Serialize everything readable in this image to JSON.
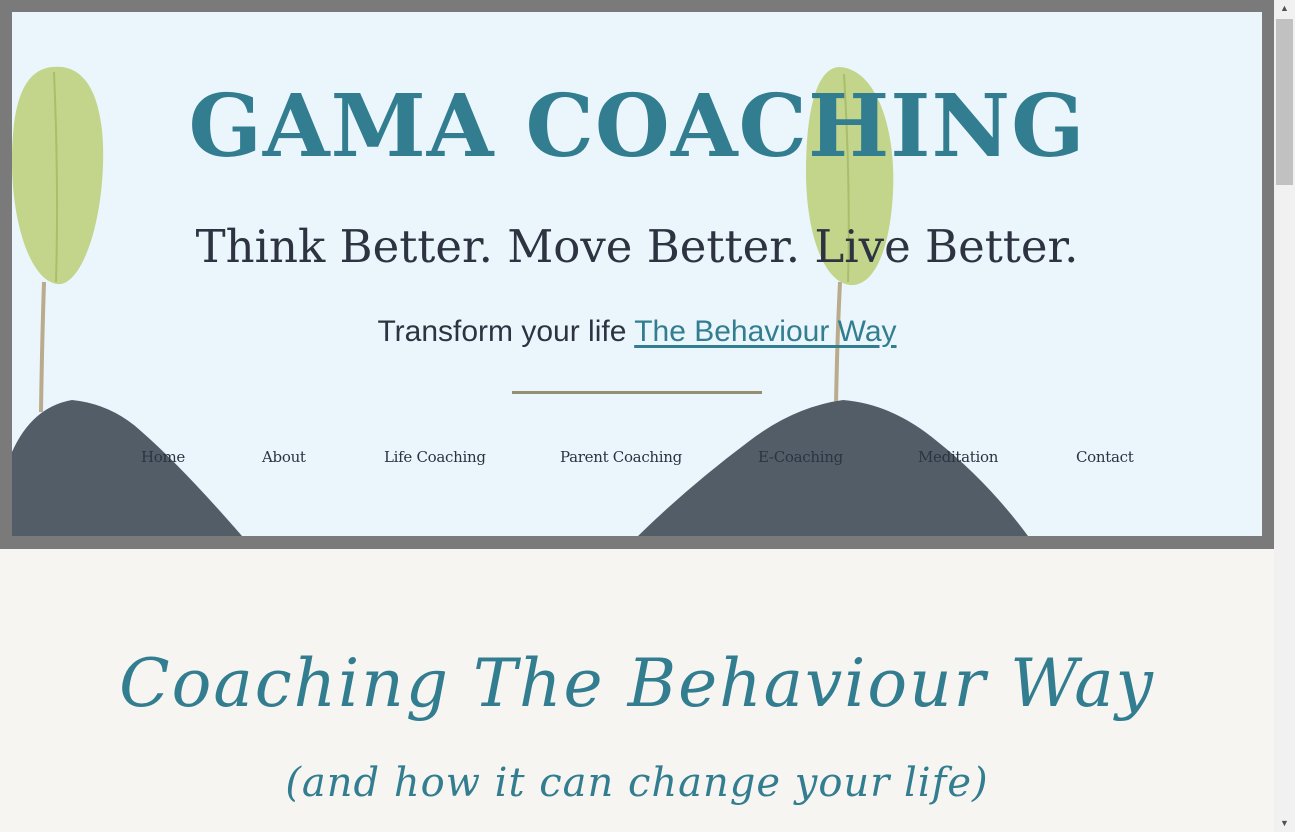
{
  "header": {
    "title": "GAMA COACHING",
    "tagline": "Think Better. Move Better. Live Better.",
    "subline_text": "Transform your life ",
    "subline_link": "The Behaviour Way"
  },
  "nav": {
    "items": [
      {
        "label": "Home"
      },
      {
        "label": "About"
      },
      {
        "label": "Life Coaching"
      },
      {
        "label": "Parent Coaching"
      },
      {
        "label": "E-Coaching"
      },
      {
        "label": "Meditation"
      },
      {
        "label": "Contact"
      }
    ]
  },
  "main": {
    "heading": "Coaching The Behaviour Way",
    "subheading": "(and how it can change your life)"
  },
  "colors": {
    "accent": "#327d8f",
    "text": "#2d3341",
    "hero_bg": "#eaf6fc",
    "page_bg": "#f6f5f1",
    "rule": "#978f73"
  },
  "icons": [
    "plant-image",
    "soil-image",
    "scroll-up-arrow-icon",
    "scroll-down-arrow-icon"
  ]
}
